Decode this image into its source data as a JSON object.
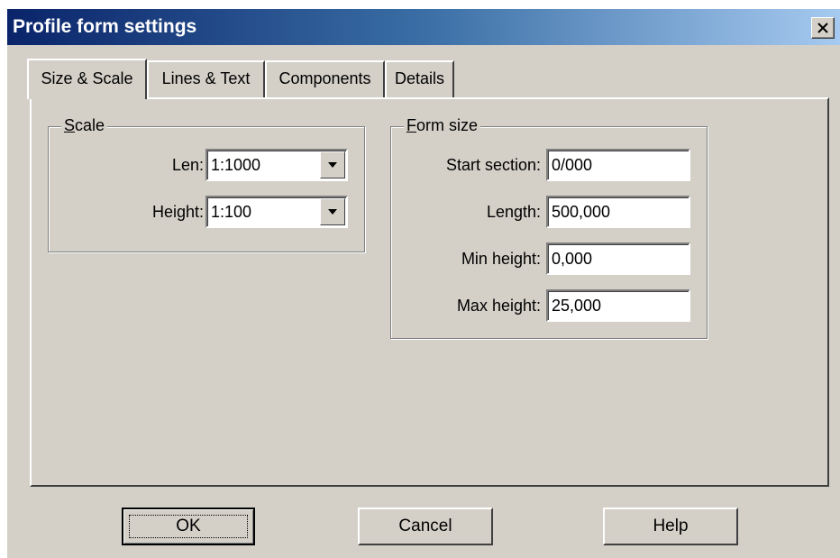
{
  "window": {
    "title": "Profile form settings",
    "close_glyph": "close-icon"
  },
  "tabs": [
    {
      "label": "Size & Scale",
      "active": true
    },
    {
      "label": "Lines & Text",
      "active": false
    },
    {
      "label": "Components",
      "active": false
    },
    {
      "label": "Details",
      "active": false
    }
  ],
  "scale": {
    "title_mnemonic": "S",
    "title_rest": "cale",
    "len_label": "Len:",
    "len_value": "1:1000",
    "height_label": "Height:",
    "height_value": "1:100"
  },
  "form_size": {
    "title_mnemonic": "F",
    "title_rest": "orm size",
    "start_section_label": "Start section:",
    "start_section_value": "0/000",
    "length_label": "Length:",
    "length_value": "500,000",
    "min_height_label": "Min height:",
    "min_height_value": "0,000",
    "max_height_label": "Max height:",
    "max_height_value": "25,000"
  },
  "buttons": {
    "ok": "OK",
    "cancel": "Cancel",
    "help": "Help"
  }
}
